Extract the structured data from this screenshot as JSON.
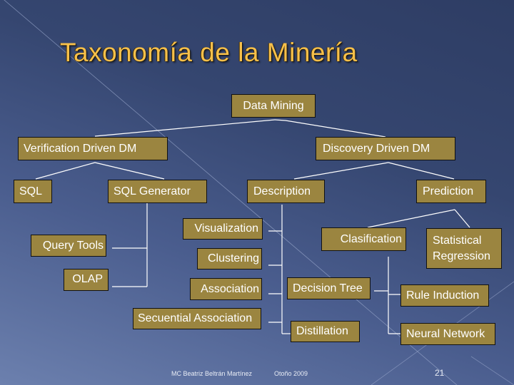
{
  "slide": {
    "title": "Taxonomía de la Minería",
    "page_number": "21",
    "footer_author": "MC Beatriz Beltrán Martínez",
    "footer_date": "Otoño 2009"
  },
  "colors": {
    "title": "#f7c04a",
    "node_fill": "#9b8540",
    "node_text": "#ffffff",
    "connector": "#ffffff",
    "background_top": "#2e3d64",
    "background_bottom": "#6c80ae"
  },
  "diagram": {
    "root": "Data Mining",
    "level1": {
      "verification": "Verification Driven DM",
      "discovery": "Discovery Driven DM"
    },
    "verification_children": {
      "sql": "SQL",
      "sql_generator": "SQL Generator"
    },
    "sql_tools": {
      "query_tools": "Query Tools",
      "olap": "OLAP"
    },
    "discovery_children": {
      "description": "Description",
      "prediction": "Prediction"
    },
    "description_methods": [
      "Visualization",
      "Clustering",
      "Association",
      "Secuential Association"
    ],
    "prediction_children": {
      "clasification": "Clasification",
      "statistical_regression_line1": "Statistical",
      "statistical_regression_line2": "Regression"
    },
    "clasification_children": {
      "decision_tree": "Decision Tree",
      "distillation": "Distillation"
    },
    "decision_tree_children": {
      "rule_induction": "Rule Induction",
      "neural_network": "Neural Network"
    }
  }
}
